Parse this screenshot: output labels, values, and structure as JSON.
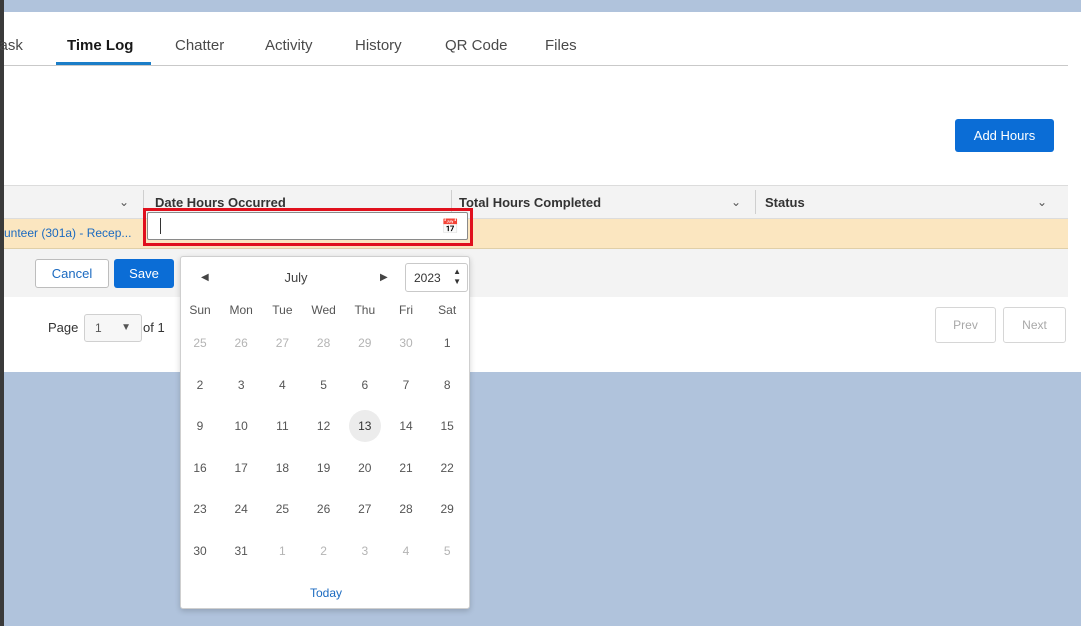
{
  "tabs": [
    {
      "label": "Task"
    },
    {
      "label": "Time Log"
    },
    {
      "label": "Chatter"
    },
    {
      "label": "Activity"
    },
    {
      "label": "History"
    },
    {
      "label": "QR Code"
    },
    {
      "label": "Files"
    }
  ],
  "add_hours_label": "Add Hours",
  "columns": [
    {
      "label": ""
    },
    {
      "label": "Date Hours Occurred"
    },
    {
      "label": "Total Hours Completed"
    },
    {
      "label": "Status"
    }
  ],
  "row": {
    "name_link": "unteer (301a) - Recep..."
  },
  "date_input": {
    "value": ""
  },
  "actions": {
    "cancel": "Cancel",
    "save": "Save"
  },
  "pager": {
    "page_label": "Page",
    "page_value": "1",
    "of_label": "of 1",
    "prev": "Prev",
    "next": "Next"
  },
  "calendar": {
    "month": "July",
    "year": "2023",
    "weekdays": [
      "Sun",
      "Mon",
      "Tue",
      "Wed",
      "Thu",
      "Fri",
      "Sat"
    ],
    "weeks": [
      [
        "25",
        "26",
        "27",
        "28",
        "29",
        "30",
        "1"
      ],
      [
        "2",
        "3",
        "4",
        "5",
        "6",
        "7",
        "8"
      ],
      [
        "9",
        "10",
        "11",
        "12",
        "13",
        "14",
        "15"
      ],
      [
        "16",
        "17",
        "18",
        "19",
        "20",
        "21",
        "22"
      ],
      [
        "23",
        "24",
        "25",
        "26",
        "27",
        "28",
        "29"
      ],
      [
        "30",
        "31",
        "1",
        "2",
        "3",
        "4",
        "5"
      ]
    ],
    "today_day": "13",
    "today_label": "Today"
  },
  "colors": {
    "accent": "#0b6dd6",
    "highlight": "#e0101d",
    "row_bg": "#fbe6c0",
    "backdrop": "#b0c3dc"
  }
}
